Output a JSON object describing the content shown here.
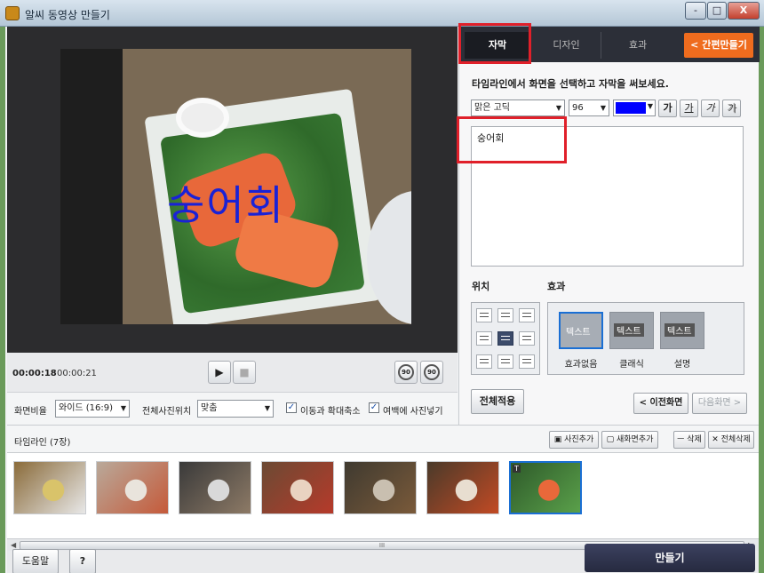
{
  "window": {
    "title": "알씨 동영상 만들기",
    "controls": {
      "minimize": "-",
      "maximize": "□",
      "close": "X"
    }
  },
  "preview": {
    "subtitle_text": "숭어회"
  },
  "player": {
    "current_time": "00:00:18",
    "total_time": "00:00:21",
    "play_icon": "▶",
    "stop_icon": "■",
    "rotate_left": "90",
    "rotate_right": "90"
  },
  "options": {
    "ratio_label": "화면비율",
    "ratio_value": "와이드 (16:9)",
    "position_label": "전체사진위치",
    "position_value": "맞춤",
    "move_zoom_label": "이동과 확대축소",
    "margin_label": "여백에 사진넣기",
    "checkbox_mark": "✓"
  },
  "panel": {
    "tabs": [
      {
        "label": "자막"
      },
      {
        "label": "디자인"
      },
      {
        "label": "효과"
      }
    ],
    "quick_button": "< 간편만들기",
    "instruction": "타임라인에서 화면을 선택하고 자막을 써보세요.",
    "font": "맑은 고딕",
    "size": "96",
    "color": "#0000ff",
    "style_buttons": [
      "가",
      "가",
      "가",
      "가"
    ],
    "text_value": "숭어회",
    "position_label": "위치",
    "effect_label": "효과",
    "effects": [
      {
        "sample": "텍스트",
        "name": "효과없음"
      },
      {
        "sample": "텍스트",
        "name": "클래식"
      },
      {
        "sample": "텍스트",
        "name": "설명"
      }
    ],
    "apply_button": "전체적용",
    "prev_button": "< 이전화면",
    "next_button": "다음화면 >"
  },
  "timeline": {
    "label": "타임라인 (7장)",
    "add_photo": "사진추가",
    "add_screen": "새화면추가",
    "delete": "ㅡ 삭제",
    "delete_all": "✕ 전체삭제",
    "selected_badge": "T",
    "thumbs": [
      {
        "colors": [
          "#8a6b3a",
          "#d9c36a",
          "#e8e8e8"
        ]
      },
      {
        "colors": [
          "#b9a99a",
          "#e9e4dc",
          "#c55a3a"
        ]
      },
      {
        "colors": [
          "#3a3a3a",
          "#d9d9d9",
          "#8d7a66"
        ]
      },
      {
        "colors": [
          "#6b4a34",
          "#e9d3c1",
          "#b63a2a"
        ]
      },
      {
        "colors": [
          "#3f3a30",
          "#c9bfb0",
          "#7a5a3a"
        ]
      },
      {
        "colors": [
          "#4a3a2a",
          "#e8ded0",
          "#c24a24"
        ]
      },
      {
        "colors": [
          "#2e5a2a",
          "#e8683a",
          "#5aa04a"
        ]
      }
    ]
  },
  "scroll": {
    "grip": "III",
    "left_arrow": "◀",
    "right_arrow": "▶"
  },
  "bottom": {
    "help_button": "도움말",
    "question_button": "?",
    "make_button": "만들기"
  }
}
